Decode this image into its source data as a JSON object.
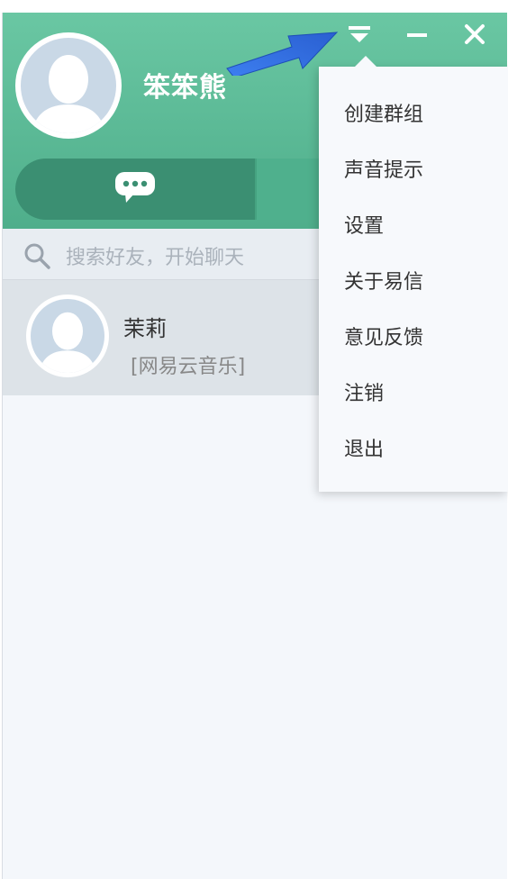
{
  "user": {
    "name": "笨笨熊"
  },
  "window_controls": {
    "menu_icon": "menu-lines-icon",
    "minimize_icon": "minimize-icon",
    "close_icon": "close-icon"
  },
  "tabs": {
    "chat_icon": "chat-bubble-icon"
  },
  "search": {
    "placeholder": "搜索好友，开始聊天",
    "icon": "search-icon"
  },
  "contacts": [
    {
      "name": "茉莉",
      "status": "[网易云音乐]"
    }
  ],
  "menu": {
    "items": [
      {
        "label": "创建群组"
      },
      {
        "label": "声音提示"
      },
      {
        "label": "设置"
      },
      {
        "label": "关于易信"
      },
      {
        "label": "意见反馈"
      },
      {
        "label": "注销"
      },
      {
        "label": "退出"
      }
    ]
  },
  "colors": {
    "header_green": "#5bbd98",
    "tab_dark": "#3b8f72",
    "annotation_arrow": "#2f6fe0"
  }
}
